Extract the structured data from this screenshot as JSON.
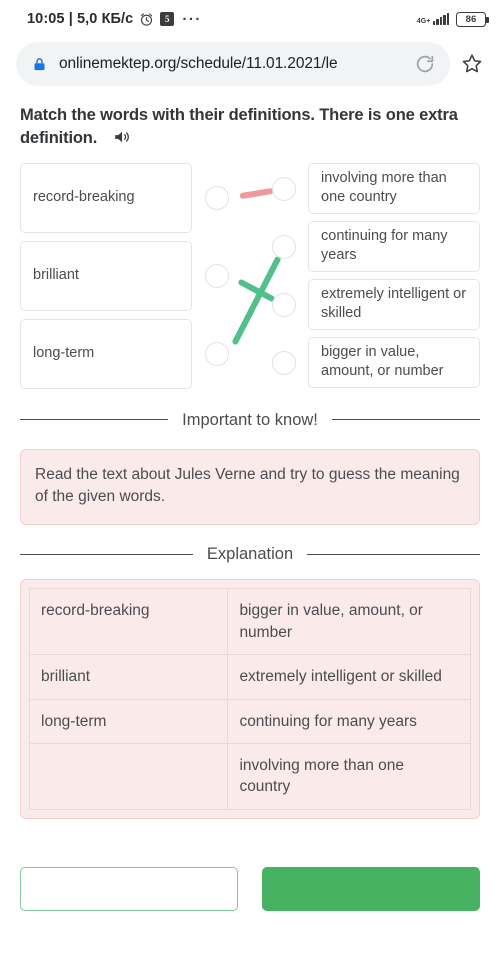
{
  "statusbar": {
    "time_and_speed": "10:05 | 5,0 КБ/с",
    "alarm_icon": "alarm-clock-icon",
    "message_icon": "message-badge-icon",
    "message_badge": "5",
    "more_icon": "···",
    "network_type": "4G+",
    "signal_icon": "signal-bars-icon",
    "battery_level": "86"
  },
  "browser": {
    "lock_icon": "lock-icon",
    "url": "onlinemektep.org/schedule/11.01.2021/le",
    "reload_icon": "reload-icon",
    "bookmark_icon": "star-icon"
  },
  "task": {
    "title": "Match the words with their definitions. There is one extra definition.",
    "audio_icon": "speaker-icon"
  },
  "match": {
    "words": [
      {
        "label": "record-breaking"
      },
      {
        "label": "brilliant"
      },
      {
        "label": "long-term"
      }
    ],
    "definitions": [
      {
        "label": "involving more than one country"
      },
      {
        "label": "continuing for many years"
      },
      {
        "label": "extremely intelligent or skilled"
      },
      {
        "label": "bigger in value, amount, or number"
      }
    ],
    "connections": [
      {
        "from": 0,
        "to": 0,
        "color": "#ef9a9a",
        "state": "incorrect"
      },
      {
        "from": 1,
        "to": 2,
        "color": "#52c08a",
        "state": "correct"
      },
      {
        "from": 2,
        "to": 1,
        "color": "#52c08a",
        "state": "correct"
      }
    ]
  },
  "important_section": {
    "heading": "Important to know!",
    "body": "Read the text about Jules Verne and try to guess the meaning of the given words."
  },
  "explanation_section": {
    "heading": "Explanation",
    "rows": [
      {
        "word": "record-breaking",
        "definition": "bigger in value, amount, or number"
      },
      {
        "word": "brilliant",
        "definition": "extremely intelligent or skilled"
      },
      {
        "word": "long-term",
        "definition": "continuing for many years"
      },
      {
        "word": "",
        "definition": "involving more than one country"
      }
    ]
  },
  "footer": {
    "secondary_label": "",
    "primary_label": ""
  },
  "colors": {
    "accent_green": "#46b262",
    "line_green": "#52c08a",
    "line_red": "#ef9a9a",
    "panel_pink": "#fbeaea",
    "panel_pink_border": "#f2d0d0"
  }
}
